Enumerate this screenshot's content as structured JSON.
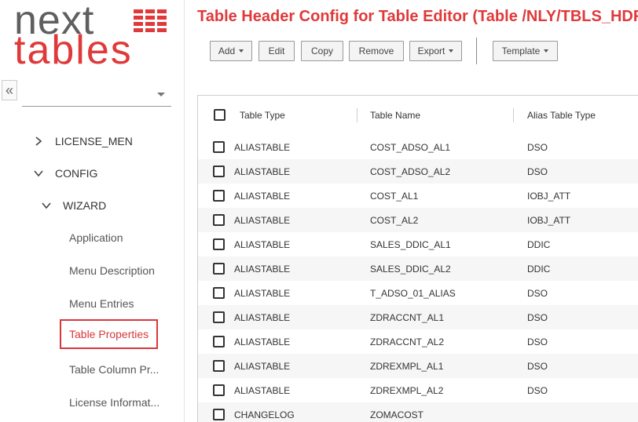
{
  "logo": {
    "line1": "next",
    "line2": "tables"
  },
  "sidebar": {
    "collapse_glyph": "«",
    "select_value": "",
    "nav": [
      {
        "label": "LICENSE_MEN",
        "expanded": false
      },
      {
        "label": "CONFIG",
        "expanded": true
      },
      {
        "label": "WIZARD",
        "expanded": true
      }
    ],
    "sub_items": [
      {
        "label": "Application"
      },
      {
        "label": "Menu Description"
      },
      {
        "label": "Menu Entries"
      },
      {
        "label": "Table Properties",
        "active": true
      },
      {
        "label": "Table Column Pr..."
      },
      {
        "label": "License Informat..."
      }
    ]
  },
  "page": {
    "title": "Table Header Config for Table Editor (Table /NLY/TBLS_HDR)"
  },
  "toolbar": {
    "add": "Add",
    "edit": "Edit",
    "copy": "Copy",
    "remove": "Remove",
    "export": "Export",
    "template": "Template"
  },
  "table": {
    "columns": [
      "Table Type",
      "Table Name",
      "Alias Table Type"
    ],
    "rows": [
      [
        "ALIASTABLE",
        "COST_ADSO_AL1",
        "DSO"
      ],
      [
        "ALIASTABLE",
        "COST_ADSO_AL2",
        "DSO"
      ],
      [
        "ALIASTABLE",
        "COST_AL1",
        "IOBJ_ATT"
      ],
      [
        "ALIASTABLE",
        "COST_AL2",
        "IOBJ_ATT"
      ],
      [
        "ALIASTABLE",
        "SALES_DDIC_AL1",
        "DDIC"
      ],
      [
        "ALIASTABLE",
        "SALES_DDIC_AL2",
        "DDIC"
      ],
      [
        "ALIASTABLE",
        "T_ADSO_01_ALIAS",
        "DSO"
      ],
      [
        "ALIASTABLE",
        "ZDRACCNT_AL1",
        "DSO"
      ],
      [
        "ALIASTABLE",
        "ZDRACCNT_AL2",
        "DSO"
      ],
      [
        "ALIASTABLE",
        "ZDREXMPL_AL1",
        "DSO"
      ],
      [
        "ALIASTABLE",
        "ZDREXMPL_AL2",
        "DSO"
      ],
      [
        "CHANGELOG",
        "ZOMACOST",
        ""
      ]
    ]
  },
  "colors": {
    "accent": "#e0393a",
    "logo_gray": "#5f5f5f"
  }
}
